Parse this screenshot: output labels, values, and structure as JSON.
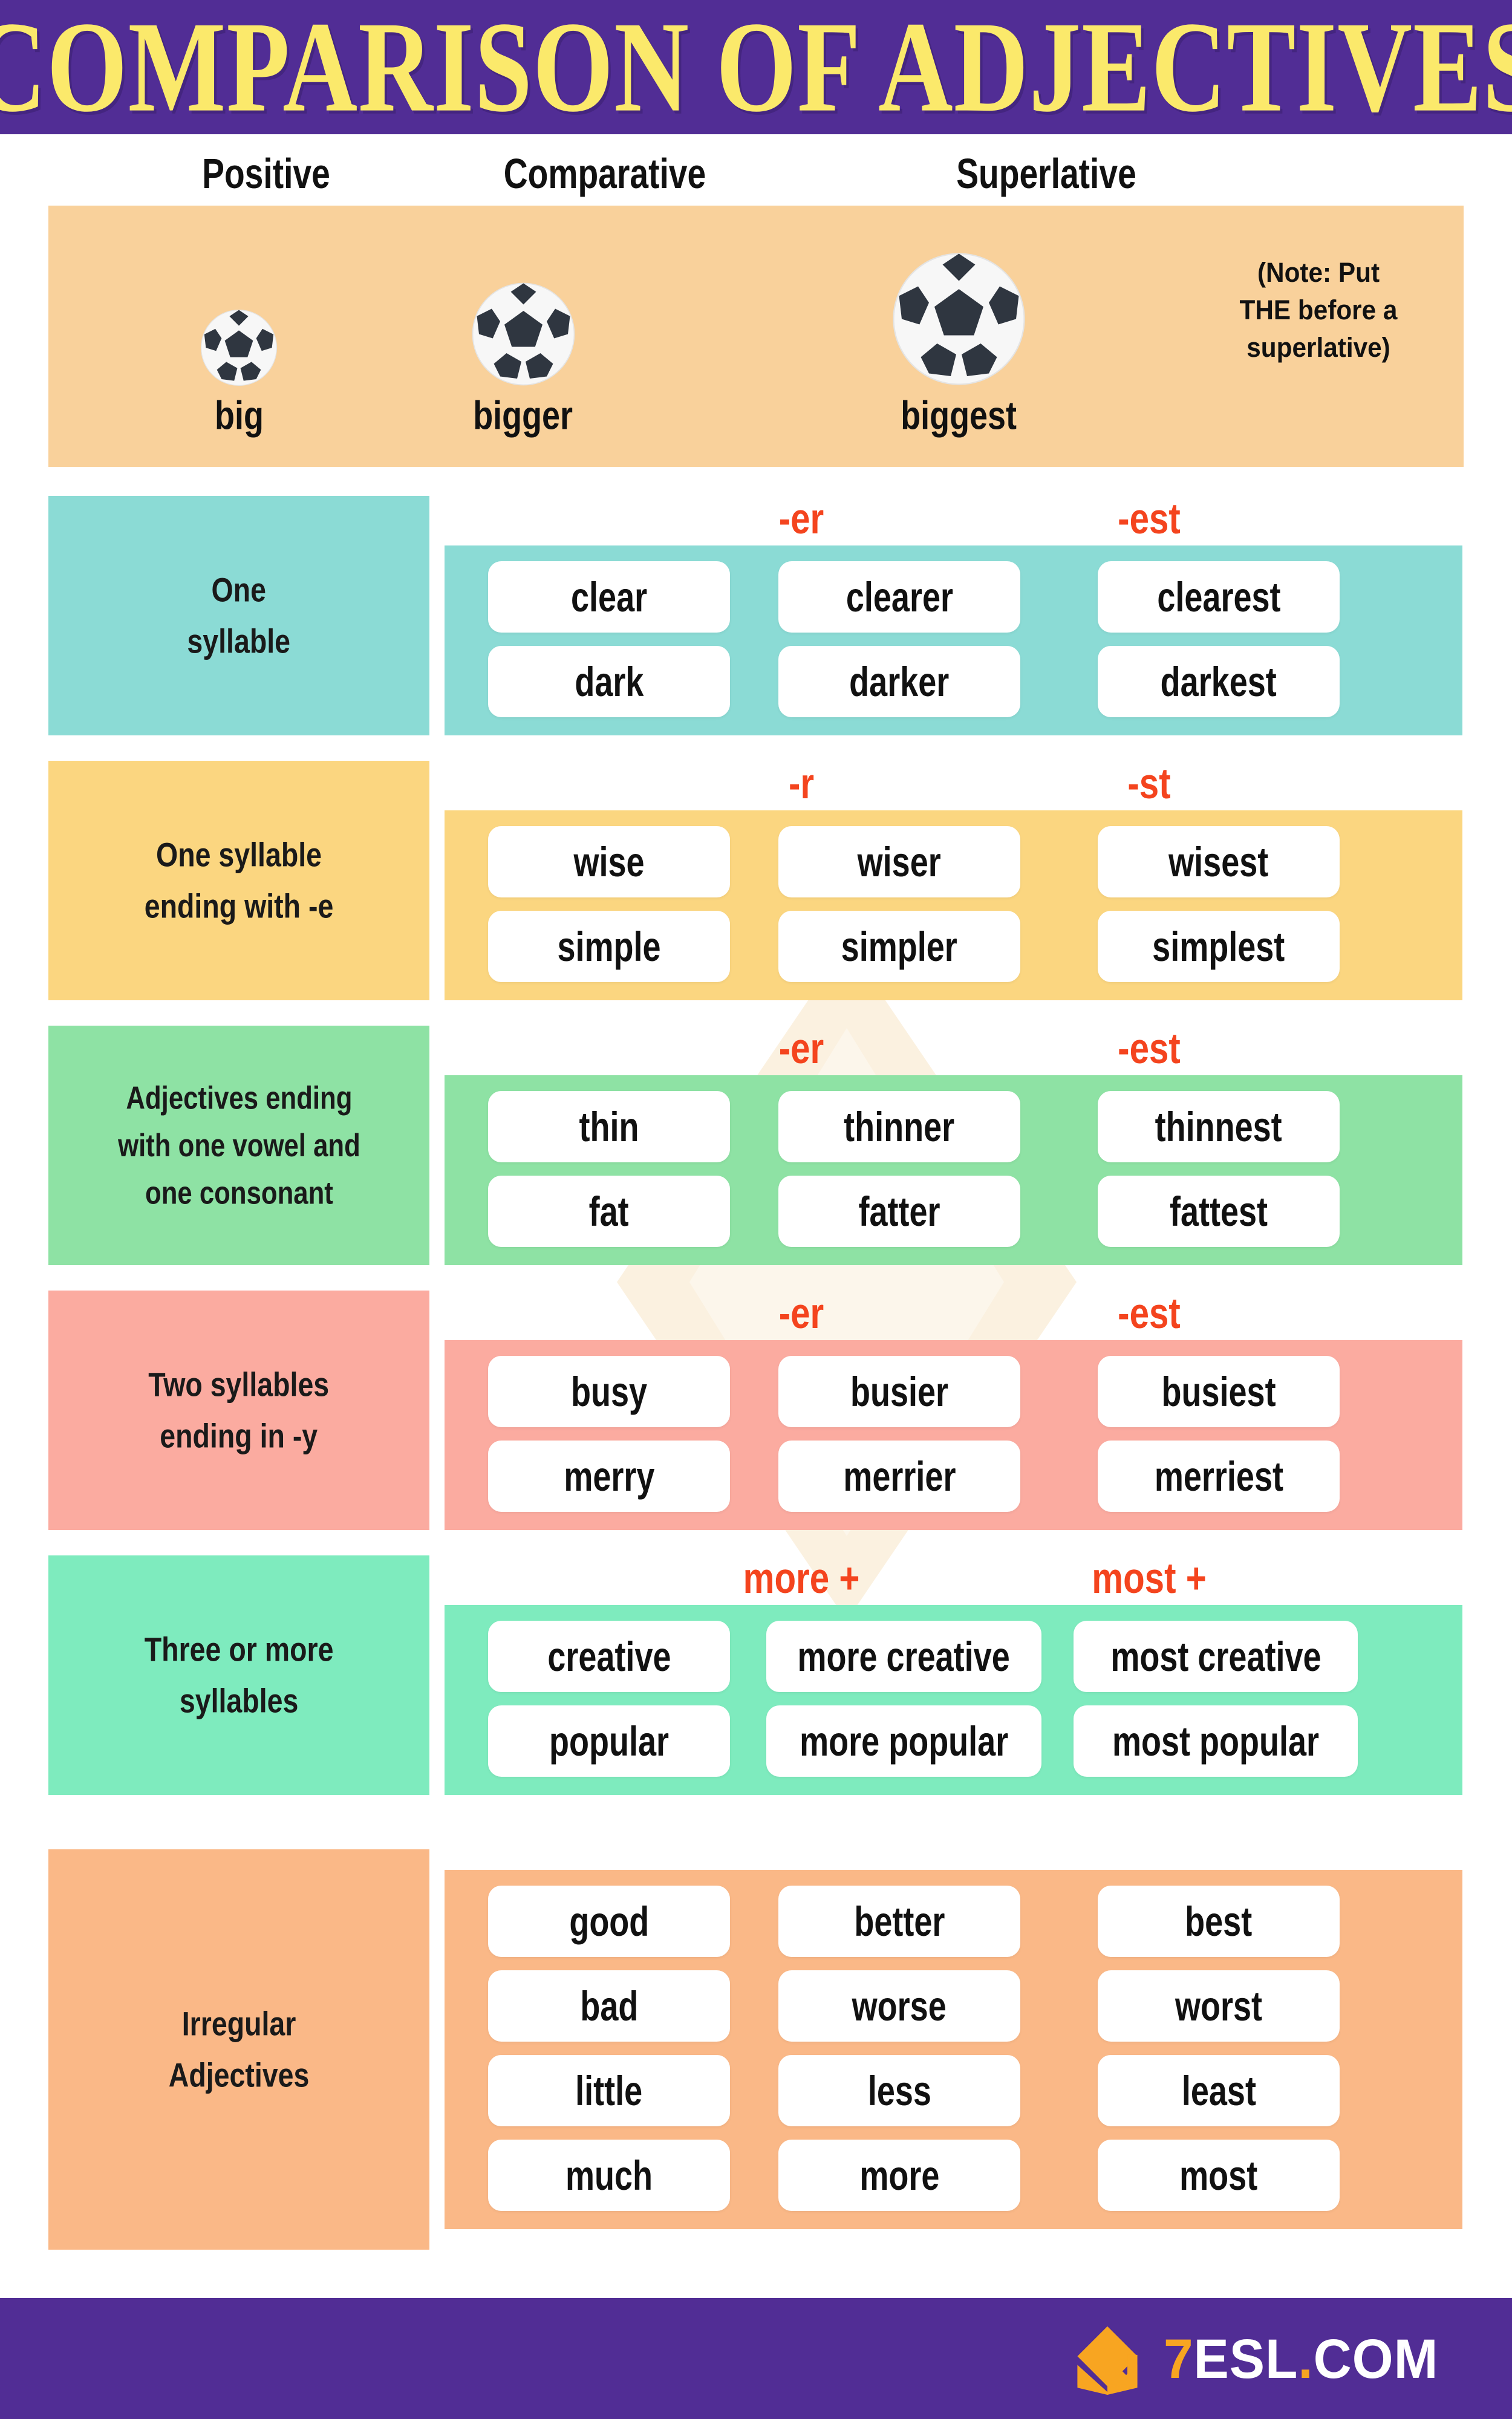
{
  "title": "COMPARISON OF ADJECTIVES",
  "colors": {
    "banner_purple": "#512D95",
    "title_yellow": "#FBE96B",
    "suffix_red": "#F4441E",
    "intro_peach": "#F9D19B",
    "row1_teal": "#8BDBD5",
    "row2_yellow": "#FBD680",
    "row3_green": "#8EE2A4",
    "row4_salmon": "#FBABA0",
    "row5_mint": "#7EEBBE",
    "row6_orange": "#FAB887",
    "card_white": "#FFFFFF",
    "logo_orange": "#F8A521"
  },
  "columns": {
    "positive": "Positive",
    "comparative": "Comparative",
    "superlative": "Superlative"
  },
  "intro": {
    "positive_word": "big",
    "comparative_word": "bigger",
    "superlative_word": "biggest",
    "note_lines": [
      "(Note: Put",
      "THE before a",
      "superlative)"
    ],
    "note_full": "(Note: Put THE before a superlative)"
  },
  "rules": [
    {
      "id": "one-syllable",
      "label_lines": [
        "One",
        "syllable"
      ],
      "label": "One syllable",
      "suffix_comparative": "-er",
      "suffix_superlative": "-est",
      "bg": "#8BDBD5",
      "wide": false,
      "rows": [
        {
          "positive": "clear",
          "comparative": "clearer",
          "superlative": "clearest"
        },
        {
          "positive": "dark",
          "comparative": "darker",
          "superlative": "darkest"
        }
      ]
    },
    {
      "id": "one-syllable-ending-e",
      "label_lines": [
        "One syllable",
        "ending with -e"
      ],
      "label": "One syllable ending with -e",
      "suffix_comparative": "-r",
      "suffix_superlative": "-st",
      "bg": "#FBD680",
      "wide": false,
      "rows": [
        {
          "positive": "wise",
          "comparative": "wiser",
          "superlative": "wisest"
        },
        {
          "positive": "simple",
          "comparative": "simpler",
          "superlative": "simplest"
        }
      ]
    },
    {
      "id": "one-vowel-one-consonant",
      "label_lines": [
        "Adjectives ending",
        "with one vowel and",
        "one consonant"
      ],
      "label": "Adjectives ending with one vowel and one consonant",
      "suffix_comparative": "-er",
      "suffix_superlative": "-est",
      "bg": "#8EE2A4",
      "wide": false,
      "rows": [
        {
          "positive": "thin",
          "comparative": "thinner",
          "superlative": "thinnest"
        },
        {
          "positive": "fat",
          "comparative": "fatter",
          "superlative": "fattest"
        }
      ]
    },
    {
      "id": "two-syllables-y",
      "label_lines": [
        "Two syllables",
        "ending in -y"
      ],
      "label": "Two syllables ending in -y",
      "suffix_comparative": "-er",
      "suffix_superlative": "-est",
      "bg": "#FBABA0",
      "wide": false,
      "rows": [
        {
          "positive": "busy",
          "comparative": "busier",
          "superlative": "busiest"
        },
        {
          "positive": "merry",
          "comparative": "merrier",
          "superlative": "merriest"
        }
      ]
    },
    {
      "id": "three-or-more-syllables",
      "label_lines": [
        "Three or more",
        "syllables"
      ],
      "label": "Three or more syllables",
      "suffix_comparative": "more +",
      "suffix_superlative": "most +",
      "bg": "#7EEBBE",
      "wide": true,
      "rows": [
        {
          "positive": "creative",
          "comparative": "more creative",
          "superlative": "most creative"
        },
        {
          "positive": "popular",
          "comparative": "more popular",
          "superlative": "most popular"
        }
      ]
    },
    {
      "id": "irregular-adjectives",
      "label_lines": [
        "Irregular",
        "Adjectives"
      ],
      "label": "Irregular Adjectives",
      "suffix_comparative": "",
      "suffix_superlative": "",
      "bg": "#FAB887",
      "wide": false,
      "rows": [
        {
          "positive": "good",
          "comparative": "better",
          "superlative": "best"
        },
        {
          "positive": "bad",
          "comparative": "worse",
          "superlative": "worst"
        },
        {
          "positive": "little",
          "comparative": "less",
          "superlative": "least"
        },
        {
          "positive": "much",
          "comparative": "more",
          "superlative": "most"
        }
      ]
    }
  ],
  "footer": {
    "logo_seven": "7",
    "logo_esl": "ESL",
    "logo_dot": ".",
    "logo_com": "COM",
    "logo_full": "7ESL.COM"
  }
}
